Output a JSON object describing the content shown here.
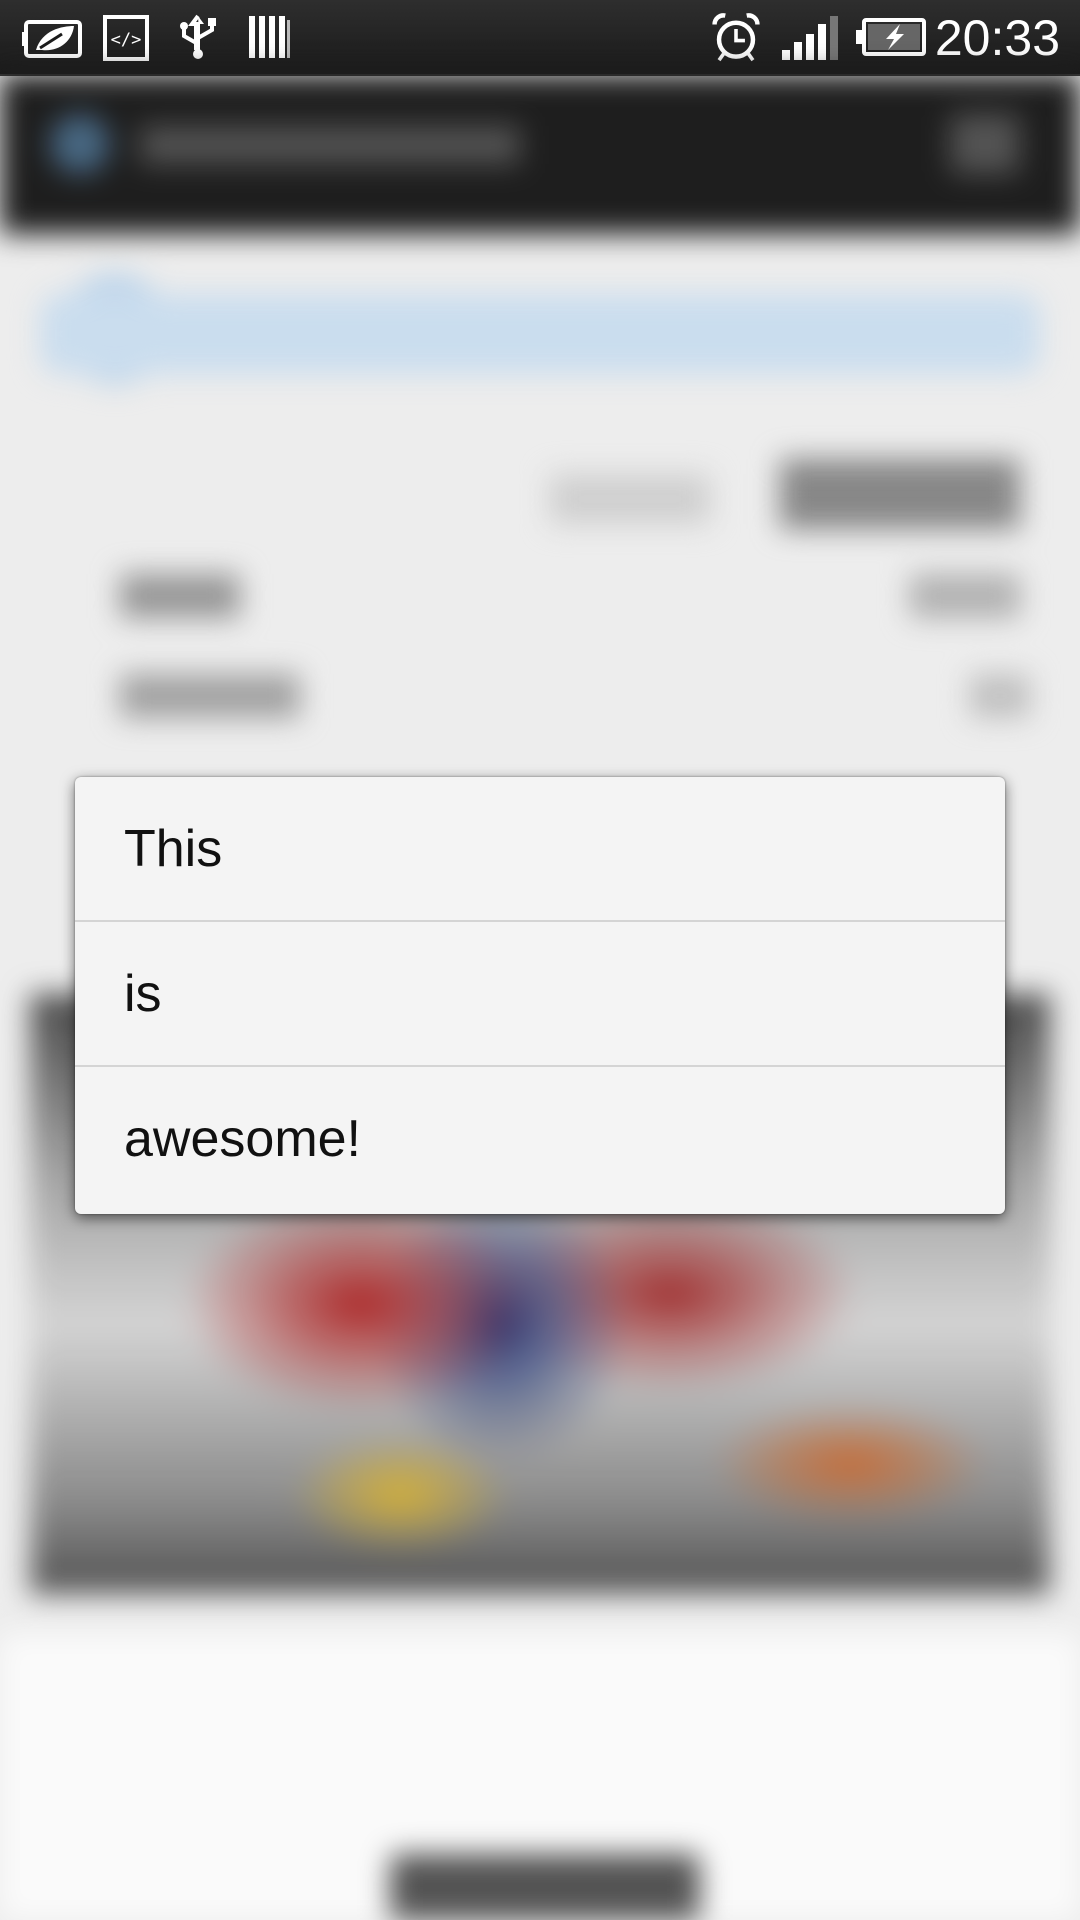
{
  "status_bar": {
    "time": "20:33",
    "icons": [
      "htc-sense-icon",
      "developer-code-icon",
      "usb-icon",
      "barcode-icon",
      "alarm-clock-icon",
      "signal-strength-icon",
      "battery-charging-icon"
    ],
    "signal_level": 0.8,
    "battery_level": 0.7
  },
  "popup_menu": {
    "items": [
      {
        "label": "This"
      },
      {
        "label": "is"
      },
      {
        "label": "awesome!"
      }
    ]
  },
  "colors": {
    "status_bar_bg": "#1a1a1a",
    "popup_bg": "#f4f4f4",
    "divider": "#d4d4d4",
    "text": "#111111"
  }
}
